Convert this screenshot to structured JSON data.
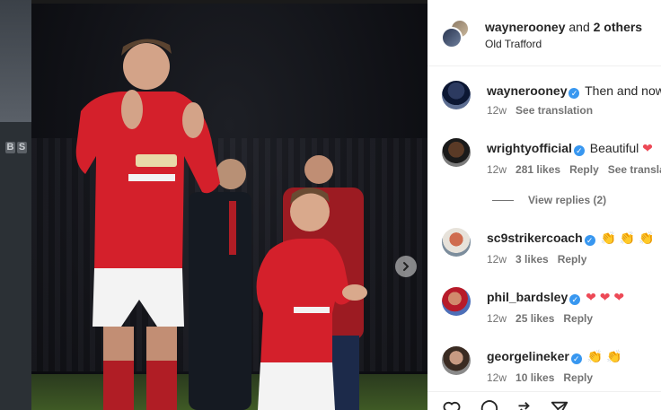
{
  "backdrop": {
    "letters": [
      "B",
      "S"
    ]
  },
  "header": {
    "username": "waynerooney",
    "and_text": " and ",
    "others": "2 others",
    "location": "Old Trafford"
  },
  "comments": [
    {
      "user": "waynerooney",
      "verified": true,
      "text": "Then and now.",
      "time": "12w",
      "likes": "",
      "reply": "",
      "translation": "See translation"
    },
    {
      "user": "wrightyofficial",
      "verified": true,
      "text": "Beautiful",
      "emoji": "❤",
      "time": "12w",
      "likes": "281 likes",
      "reply": "Reply",
      "translation": "See translat"
    },
    {
      "user": "sc9strikercoach",
      "verified": true,
      "text": "",
      "emoji": "👏 👏 👏",
      "time": "12w",
      "likes": "3 likes",
      "reply": "Reply"
    },
    {
      "user": "phil_bardsley",
      "verified": true,
      "text": "",
      "emoji": "❤ ❤ ❤",
      "time": "12w",
      "likes": "25 likes",
      "reply": "Reply"
    },
    {
      "user": "georgelineker",
      "verified": true,
      "text": "",
      "emoji": "👏 👏",
      "time": "12w",
      "likes": "10 likes",
      "reply": "Reply"
    }
  ],
  "view_replies": "View replies (2)",
  "icons": [
    "heart-icon",
    "comment-icon",
    "share-icon",
    "send-icon",
    "chevron-right-icon"
  ]
}
